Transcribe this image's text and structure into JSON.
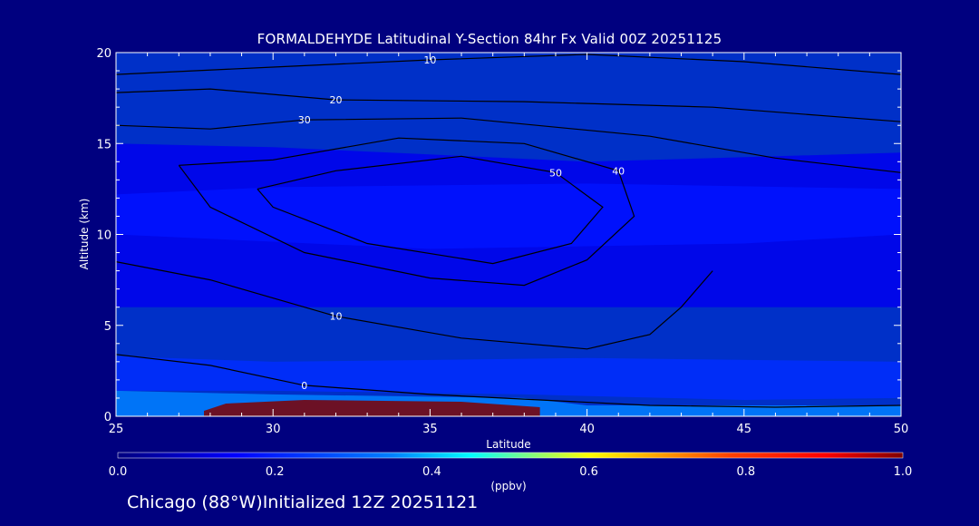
{
  "chart_data": {
    "type": "heatmap",
    "title": "FORMALDEHYDE Latitudinal Y-Section 84hr  Fx Valid 00Z 20251125",
    "xlabel": "Latitude",
    "ylabel": "Altitude (km)",
    "xlim": [
      25,
      50
    ],
    "ylim": [
      0,
      20
    ],
    "x_ticks": [
      "25",
      "30",
      "35",
      "40",
      "45",
      "50"
    ],
    "y_ticks": [
      "0",
      "5",
      "10",
      "15",
      "20"
    ],
    "colorbar": {
      "label": "(ppbv)",
      "range": [
        0.0,
        1.0
      ],
      "ticks": [
        "0.0",
        "0.2",
        "0.4",
        "0.6",
        "0.8",
        "1.0"
      ]
    },
    "filled_regions": [
      {
        "name": "surface-layer",
        "value": 0.35,
        "poly": [
          [
            25,
            0
          ],
          [
            50,
            0
          ],
          [
            50,
            0.6
          ],
          [
            40,
            0.6
          ],
          [
            38,
            1.0
          ],
          [
            30,
            1.2
          ],
          [
            25,
            1.4
          ]
        ]
      },
      {
        "name": "plume-high",
        "value": 1.0,
        "poly": [
          [
            27.8,
            0
          ],
          [
            38.5,
            0
          ],
          [
            38.5,
            0.5
          ],
          [
            36,
            0.8
          ],
          [
            31,
            0.9
          ],
          [
            28.5,
            0.7
          ],
          [
            27.8,
            0.3
          ]
        ]
      },
      {
        "name": "low-layer-mid",
        "value": 0.22,
        "poly": [
          [
            25,
            1.4
          ],
          [
            30,
            1.4
          ],
          [
            38,
            1.2
          ],
          [
            45,
            0.9
          ],
          [
            50,
            1.0
          ],
          [
            50,
            3
          ],
          [
            40,
            3.2
          ],
          [
            30,
            3
          ],
          [
            25,
            3.3
          ]
        ]
      },
      {
        "name": "upper-band",
        "value": 0.13,
        "poly": [
          [
            25,
            6
          ],
          [
            50,
            6
          ],
          [
            50,
            14.5
          ],
          [
            40,
            14
          ],
          [
            30,
            14.8
          ],
          [
            25,
            15
          ]
        ]
      },
      {
        "name": "jet-core",
        "value": 0.18,
        "poly": [
          [
            25,
            10
          ],
          [
            35,
            9.2
          ],
          [
            45,
            9.5
          ],
          [
            50,
            10
          ],
          [
            50,
            12.5
          ],
          [
            40,
            12.8
          ],
          [
            30,
            12.6
          ],
          [
            25,
            12.2
          ]
        ]
      }
    ],
    "contours": [
      {
        "label": "10",
        "points": [
          [
            25,
            18.8
          ],
          [
            30,
            19.2
          ],
          [
            35,
            19.6
          ],
          [
            40,
            19.9
          ],
          [
            45,
            19.5
          ],
          [
            50,
            18.8
          ]
        ]
      },
      {
        "label": "20",
        "points": [
          [
            25,
            17.8
          ],
          [
            28,
            18.0
          ],
          [
            32,
            17.4
          ],
          [
            38,
            17.3
          ],
          [
            44,
            17.0
          ],
          [
            50,
            16.2
          ]
        ]
      },
      {
        "label": "30",
        "points": [
          [
            25,
            16.0
          ],
          [
            28,
            15.8
          ],
          [
            31,
            16.3
          ],
          [
            36,
            16.4
          ],
          [
            42,
            15.4
          ],
          [
            46,
            14.2
          ],
          [
            50,
            13.4
          ]
        ]
      },
      {
        "label": "40",
        "points": [
          [
            27,
            13.8
          ],
          [
            30,
            14.1
          ],
          [
            34,
            15.3
          ],
          [
            38,
            15.0
          ],
          [
            41,
            13.5
          ],
          [
            41.5,
            11
          ],
          [
            40,
            8.6
          ],
          [
            38,
            7.2
          ],
          [
            35,
            7.6
          ],
          [
            31,
            9
          ],
          [
            28,
            11.5
          ],
          [
            27,
            13.8
          ]
        ]
      },
      {
        "label": "50",
        "points": [
          [
            29.5,
            12.5
          ],
          [
            32,
            13.5
          ],
          [
            36,
            14.3
          ],
          [
            39,
            13.4
          ],
          [
            40.5,
            11.5
          ],
          [
            39.5,
            9.5
          ],
          [
            37,
            8.4
          ],
          [
            33,
            9.5
          ],
          [
            30,
            11.5
          ],
          [
            29.5,
            12.5
          ]
        ]
      },
      {
        "label": "10",
        "points": [
          [
            25,
            8.5
          ],
          [
            28,
            7.5
          ],
          [
            32,
            5.5
          ],
          [
            36,
            4.3
          ],
          [
            40,
            3.7
          ],
          [
            42,
            4.5
          ],
          [
            43,
            6
          ],
          [
            44,
            8
          ]
        ]
      },
      {
        "label": "0",
        "points": [
          [
            25,
            3.4
          ],
          [
            28,
            2.8
          ],
          [
            31,
            1.7
          ],
          [
            35,
            1.2
          ],
          [
            38.5,
            0.9
          ],
          [
            42,
            0.6
          ],
          [
            46,
            0.5
          ],
          [
            50,
            0.6
          ]
        ]
      }
    ]
  },
  "footer": "Chicago (88°W)Initialized 12Z 20251121"
}
